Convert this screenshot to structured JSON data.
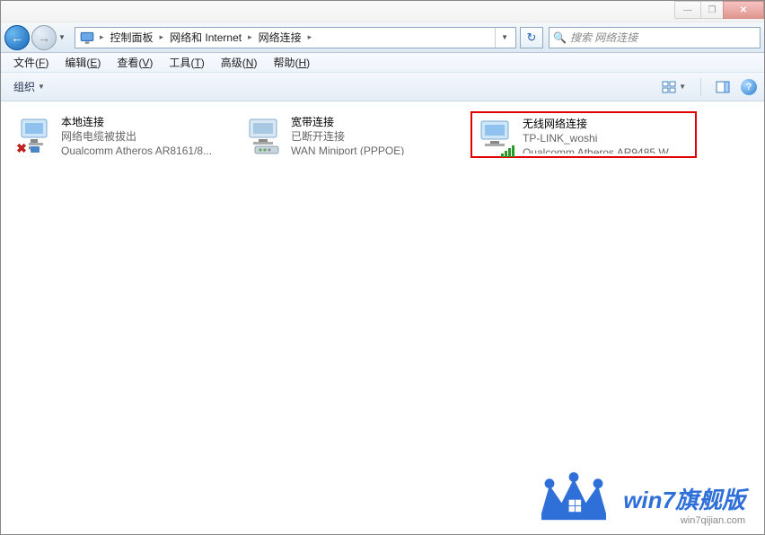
{
  "title": "网络连接",
  "window_controls": {
    "min": "—",
    "max": "❐",
    "close": "✕"
  },
  "nav": {
    "back_icon": "←",
    "fwd_icon": "→",
    "dropdown": "▼",
    "refresh": "↻"
  },
  "breadcrumbs": {
    "root_icon": "▸",
    "sep": "▸",
    "items": [
      "控制面板",
      "网络和 Internet",
      "网络连接"
    ],
    "dropdown": "▼"
  },
  "search": {
    "placeholder": "搜索 网络连接",
    "icon": "🔍"
  },
  "menus": [
    {
      "label": "文件",
      "key": "F"
    },
    {
      "label": "编辑",
      "key": "E"
    },
    {
      "label": "查看",
      "key": "V"
    },
    {
      "label": "工具",
      "key": "T"
    },
    {
      "label": "高级",
      "key": "N"
    },
    {
      "label": "帮助",
      "key": "H"
    }
  ],
  "toolbar": {
    "organize": "组织",
    "dd": "▼",
    "help": "?"
  },
  "connections": [
    {
      "name": "本地连接",
      "status": "网络电缆被拔出",
      "device": "Qualcomm Atheros AR8161/8...",
      "icon_type": "ethernet",
      "overlay": "x",
      "highlighted": false
    },
    {
      "name": "宽带连接",
      "status": "已断开连接",
      "device": "WAN Miniport (PPPOE)",
      "icon_type": "modem",
      "overlay": "none",
      "highlighted": false
    },
    {
      "name": "无线网络连接",
      "status": "TP-LINK_woshi",
      "device": "Qualcomm Atheros AR9485 W...",
      "icon_type": "wireless",
      "overlay": "signal",
      "highlighted": true
    }
  ],
  "watermark": {
    "main": "win7旗舰版",
    "sub": "win7qijian.com"
  }
}
